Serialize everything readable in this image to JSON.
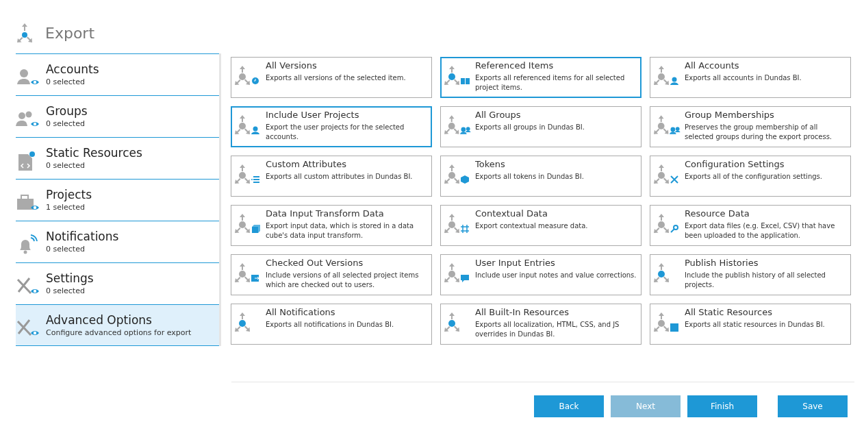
{
  "title": "Export",
  "sidebar": {
    "items": [
      {
        "kind": "account",
        "label": "Accounts",
        "detail": "0 selected",
        "selected": false
      },
      {
        "kind": "group",
        "label": "Groups",
        "detail": "0 selected",
        "selected": false
      },
      {
        "kind": "code",
        "label": "Static Resources",
        "detail": "0 selected",
        "selected": false
      },
      {
        "kind": "project",
        "label": "Projects",
        "detail": "1 selected",
        "selected": false
      },
      {
        "kind": "bell",
        "label": "Notifications",
        "detail": "0 selected",
        "selected": false
      },
      {
        "kind": "tools",
        "label": "Settings",
        "detail": "0 selected",
        "selected": false
      },
      {
        "kind": "tools",
        "label": "Advanced Options",
        "detail": "Configure advanced options for export",
        "selected": true
      }
    ]
  },
  "options": [
    {
      "title": "All Versions",
      "description": "Exports all versions of the selected item.",
      "selected": false,
      "dot_active": false,
      "kind": "clock"
    },
    {
      "title": "Referenced Items",
      "description": "Exports all referenced items for all selected project items.",
      "selected": true,
      "dot_active": true,
      "kind": "book"
    },
    {
      "title": "All Accounts",
      "description": "Exports all accounts in Dundas BI.",
      "selected": false,
      "dot_active": false,
      "kind": "person"
    },
    {
      "title": "Include User Projects",
      "description": "Export the user projects for the selected accounts.",
      "selected": true,
      "dot_active": false,
      "kind": "person"
    },
    {
      "title": "All Groups",
      "description": "Exports all groups in Dundas BI.",
      "selected": false,
      "dot_active": false,
      "kind": "people"
    },
    {
      "title": "Group Memberships",
      "description": "Preserves the group membership of all selected groups during the export process.",
      "selected": false,
      "dot_active": false,
      "kind": "people"
    },
    {
      "title": "Custom Attributes",
      "description": "Exports all custom attributes in Dundas BI.",
      "selected": false,
      "dot_active": false,
      "kind": "list"
    },
    {
      "title": "Tokens",
      "description": "Exports all tokens in Dundas BI.",
      "selected": false,
      "dot_active": false,
      "kind": "token"
    },
    {
      "title": "Configuration Settings",
      "description": "Exports all of the configuration settings.",
      "selected": false,
      "dot_active": false,
      "kind": "tools"
    },
    {
      "title": "Data Input Transform Data",
      "description": "Export input data, which is stored in a data cube's data input transform.",
      "selected": false,
      "dot_active": false,
      "kind": "cube"
    },
    {
      "title": "Contextual Data",
      "description": "Export contextual measure data.",
      "selected": false,
      "dot_active": false,
      "kind": "number"
    },
    {
      "title": "Resource Data",
      "description": "Export data files (e.g. Excel, CSV) that have been uploaded to the application.",
      "selected": false,
      "dot_active": false,
      "kind": "search"
    },
    {
      "title": "Checked Out Versions",
      "description": "Include versions of all selected project items which are checked out to users.",
      "selected": false,
      "dot_active": false,
      "kind": "checkout"
    },
    {
      "title": "User Input Entries",
      "description": "Include user input notes and value corrections.",
      "selected": false,
      "dot_active": false,
      "kind": "comment"
    },
    {
      "title": "Publish Histories",
      "description": "Include the publish history of all selected projects.",
      "selected": false,
      "dot_active": true,
      "kind": "none"
    },
    {
      "title": "All Notifications",
      "description": "Exports all notifications in Dundas BI.",
      "selected": false,
      "dot_active": true,
      "kind": "none"
    },
    {
      "title": "All Built-In Resources",
      "description": "Exports all localization, HTML, CSS, and JS overrides in Dundas BI.",
      "selected": false,
      "dot_active": true,
      "kind": "none"
    },
    {
      "title": "All Static Resources",
      "description": "Exports all static resources in Dundas BI.",
      "selected": false,
      "dot_active": false,
      "kind": "code"
    }
  ],
  "buttons": [
    {
      "label": "Back",
      "disabled": false
    },
    {
      "label": "Next",
      "disabled": true
    },
    {
      "label": "Finish",
      "disabled": false
    },
    {
      "label": "Save",
      "disabled": false
    }
  ]
}
